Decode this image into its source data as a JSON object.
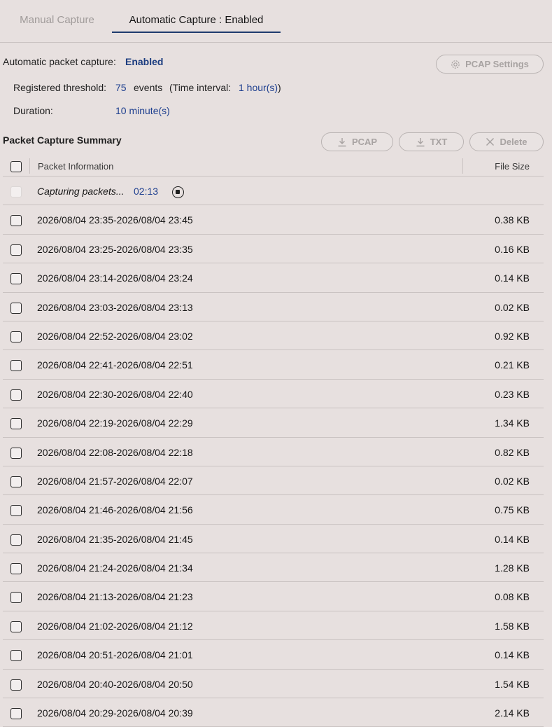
{
  "tabs": {
    "manual": "Manual Capture",
    "automatic": "Automatic Capture : Enabled"
  },
  "status": {
    "label": "Automatic packet capture:",
    "value": "Enabled"
  },
  "pcap_settings_button": "PCAP Settings",
  "threshold": {
    "label": "Registered threshold:",
    "value": "75",
    "unit": "events",
    "interval_label": "(Time interval:",
    "interval_value": "1 hour(s)",
    "interval_close": ")"
  },
  "duration": {
    "label": "Duration:",
    "value": "10 minute(s)"
  },
  "summary": {
    "title": "Packet Capture Summary",
    "buttons": {
      "pcap": "PCAP",
      "txt": "TXT",
      "delete": "Delete"
    },
    "columns": {
      "info": "Packet Information",
      "size": "File Size"
    },
    "capturing": {
      "text": "Capturing packets...",
      "timer": "02:13"
    },
    "rows": [
      {
        "info": "2026/08/04 23:35-2026/08/04 23:45",
        "size": "0.38 KB"
      },
      {
        "info": "2026/08/04 23:25-2026/08/04 23:35",
        "size": "0.16 KB"
      },
      {
        "info": "2026/08/04 23:14-2026/08/04 23:24",
        "size": "0.14 KB"
      },
      {
        "info": "2026/08/04 23:03-2026/08/04 23:13",
        "size": "0.02 KB"
      },
      {
        "info": "2026/08/04 22:52-2026/08/04 23:02",
        "size": "0.92 KB"
      },
      {
        "info": "2026/08/04 22:41-2026/08/04 22:51",
        "size": "0.21 KB"
      },
      {
        "info": "2026/08/04 22:30-2026/08/04 22:40",
        "size": "0.23 KB"
      },
      {
        "info": "2026/08/04 22:19-2026/08/04 22:29",
        "size": "1.34 KB"
      },
      {
        "info": "2026/08/04 22:08-2026/08/04 22:18",
        "size": "0.82 KB"
      },
      {
        "info": "2026/08/04 21:57-2026/08/04 22:07",
        "size": "0.02 KB"
      },
      {
        "info": "2026/08/04 21:46-2026/08/04 21:56",
        "size": "0.75 KB"
      },
      {
        "info": "2026/08/04 21:35-2026/08/04 21:45",
        "size": "0.14 KB"
      },
      {
        "info": "2026/08/04 21:24-2026/08/04 21:34",
        "size": "1.28 KB"
      },
      {
        "info": "2026/08/04 21:13-2026/08/04 21:23",
        "size": "0.08 KB"
      },
      {
        "info": "2026/08/04 21:02-2026/08/04 21:12",
        "size": "1.58 KB"
      },
      {
        "info": "2026/08/04 20:51-2026/08/04 21:01",
        "size": "0.14 KB"
      },
      {
        "info": "2026/08/04 20:40-2026/08/04 20:50",
        "size": "1.54 KB"
      },
      {
        "info": "2026/08/04 20:29-2026/08/04 20:39",
        "size": "2.14 KB"
      }
    ]
  }
}
